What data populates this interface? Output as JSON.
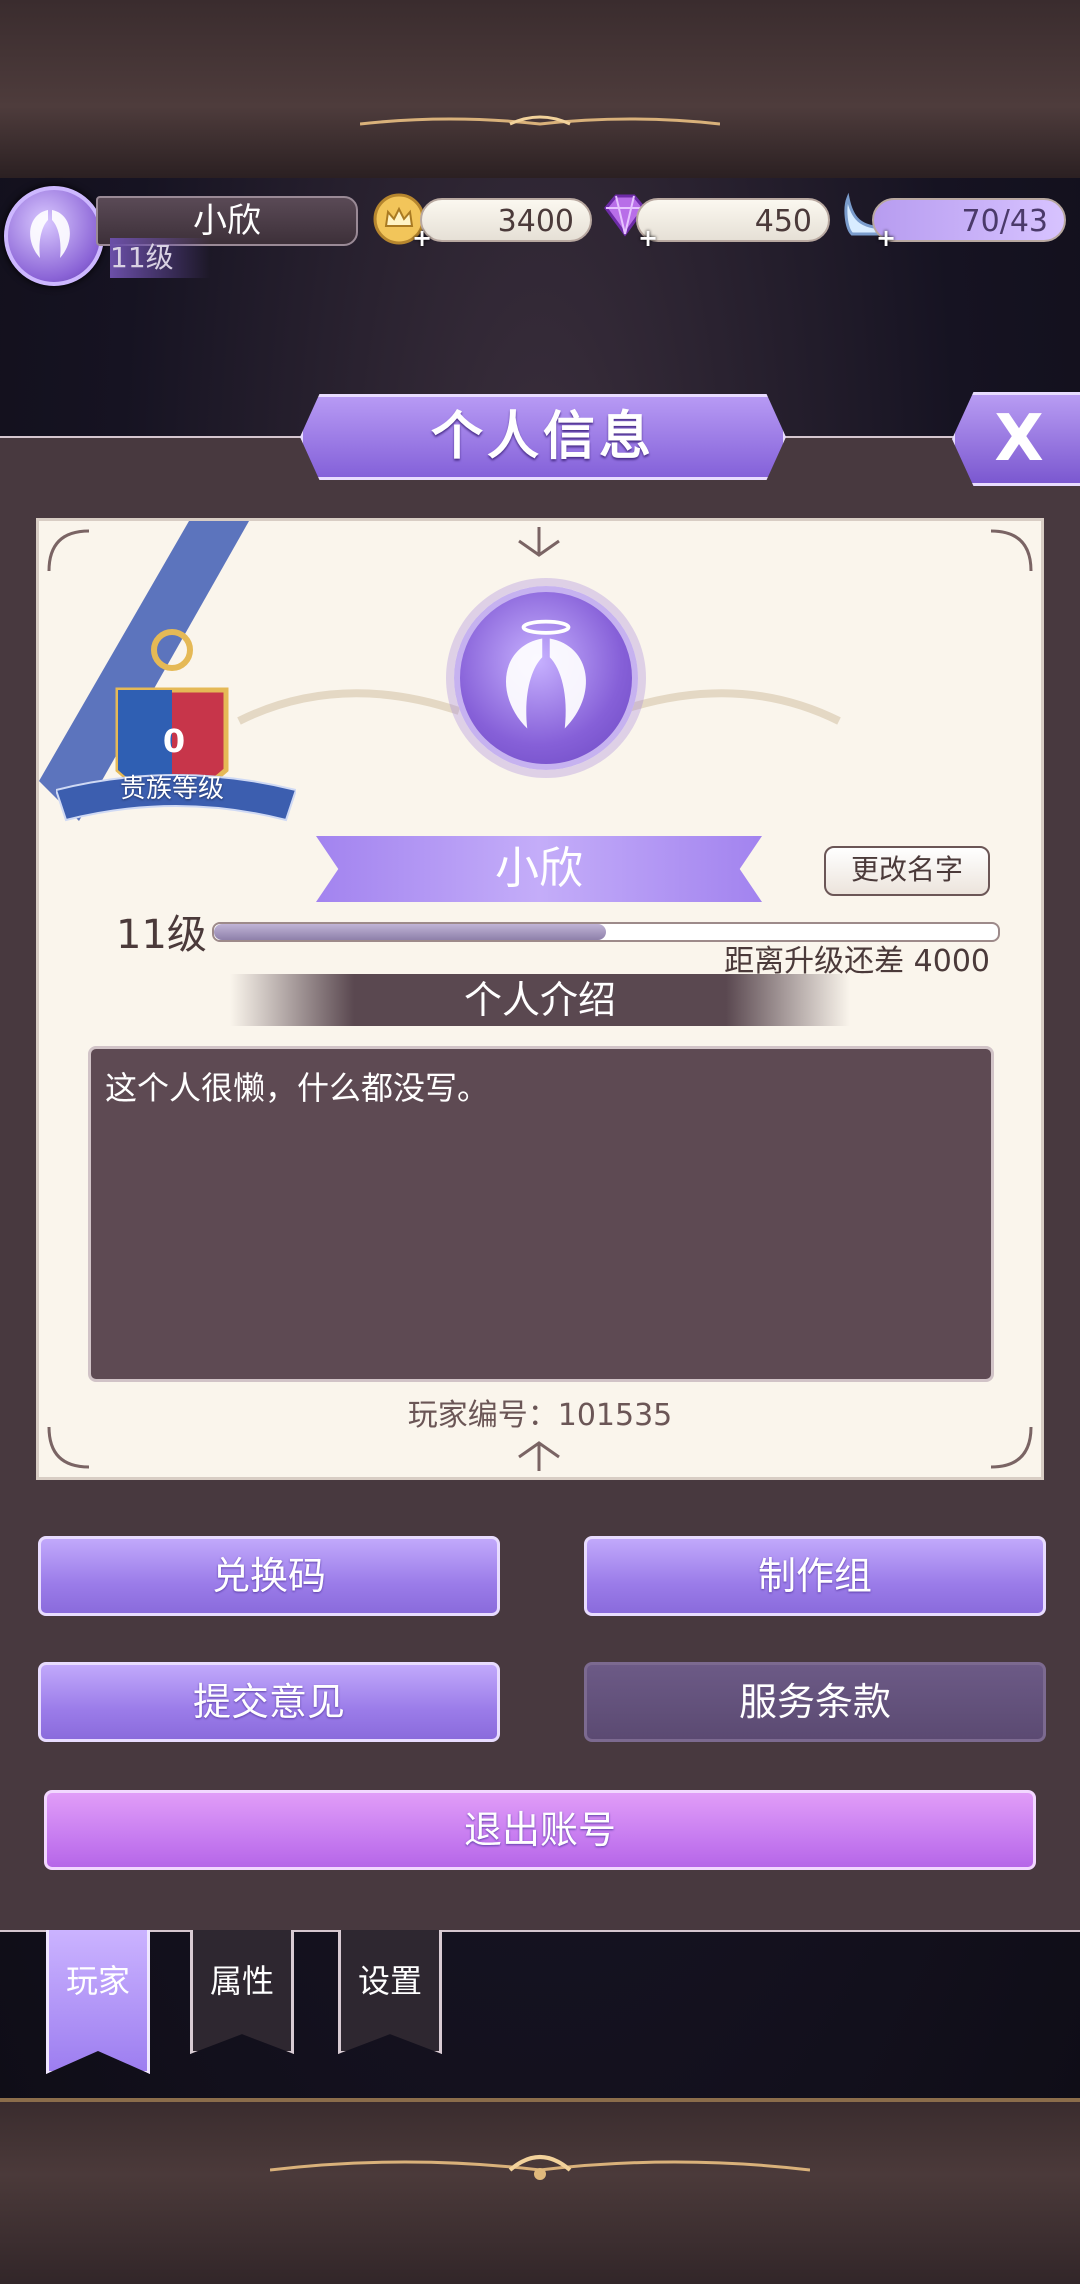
{
  "topbar": {
    "player_name": "小欣",
    "player_level": "11级",
    "gold": "3400",
    "diamonds": "450",
    "stamina": "70/43"
  },
  "dialog": {
    "title": "个人信息",
    "close_label": "X"
  },
  "profile": {
    "noble_level_value": "0",
    "noble_level_label": "贵族等级",
    "name": "小欣",
    "rename_label": "更改名字",
    "level": "11级",
    "exp_to_next": "距离升级还差 4000",
    "exp_progress": 0.5,
    "intro_title": "个人介绍",
    "intro_text": "这个人很懒，什么都没写。",
    "player_id": "玩家编号：101535"
  },
  "actions": {
    "redeem_code": "兑换码",
    "credits": "制作组",
    "feedback": "提交意见",
    "terms": "服务条款",
    "logout": "退出账号"
  },
  "tabs": [
    {
      "label": "玩家",
      "active": true
    },
    {
      "label": "属性",
      "active": false
    },
    {
      "label": "设置",
      "active": false
    }
  ],
  "colors": {
    "accent": "#9b7ce9",
    "logout": "#c77cf0",
    "panel": "#48393f",
    "card": "#faf5ec"
  }
}
